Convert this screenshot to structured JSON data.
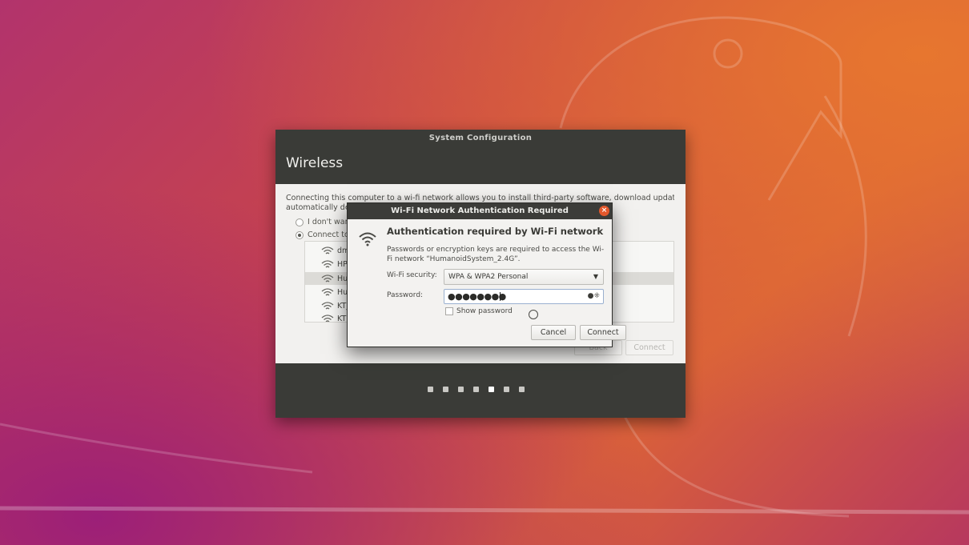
{
  "main_window": {
    "title": "System Configuration",
    "header": "Wireless",
    "intro_line1": "Connecting this computer to a wi-fi network allows you to install third-party software, download updates,",
    "intro_line2": "automatically de",
    "option_no": "I don't want",
    "option_connect": "Connect to t",
    "networks": [
      "dm",
      "HP-",
      "Hur",
      "Hur",
      "KT_",
      "KT"
    ],
    "selected_network_index": 2,
    "back_label": "Back",
    "connect_label": "Connect",
    "progress_steps": 7,
    "progress_current": 5
  },
  "dialog": {
    "title": "Wi-Fi Network Authentication Required",
    "close_symbol": "×",
    "heading": "Authentication required by Wi-Fi network",
    "description": "Passwords or encryption keys are required to access the Wi-Fi network “HumanoidSystem_2.4G”.",
    "security_label": "Wi-Fi security:",
    "security_value": "WPA & WPA2 Personal",
    "password_label": "Password:",
    "password_mask": "●●●●●●●●",
    "show_password_label": "Show password",
    "show_password_checked": false,
    "cancel_label": "Cancel",
    "connect_label": "Connect"
  },
  "colors": {
    "titlebar": "#3a3b37",
    "close_button": "#e3582c",
    "panel_background": "#f2f1ef"
  },
  "icons": {
    "network": "wifi-signal-icon",
    "password_store": "user-keys-icon",
    "dropdown": "chevron-down-icon"
  }
}
